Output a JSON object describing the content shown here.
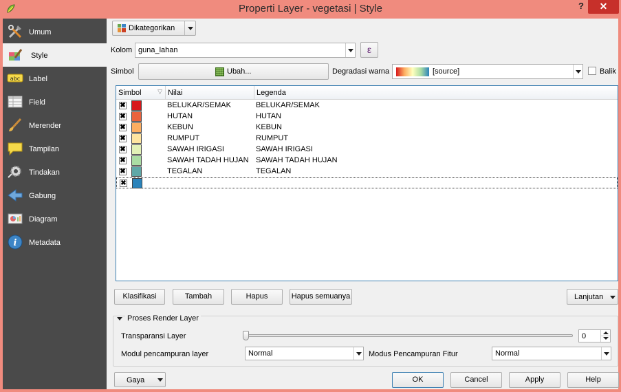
{
  "window": {
    "title": "Properti Layer - vegetasi | Style",
    "help": "?",
    "close": "✕"
  },
  "sidebar": {
    "items": [
      {
        "label": "Umum",
        "icon": "tools-icon"
      },
      {
        "label": "Style",
        "icon": "style-brush-icon",
        "active": true
      },
      {
        "label": "Label",
        "icon": "abc-label-icon"
      },
      {
        "label": "Field",
        "icon": "table-field-icon"
      },
      {
        "label": "Merender",
        "icon": "paintbrush-icon"
      },
      {
        "label": "Tampilan",
        "icon": "speech-bubble-icon"
      },
      {
        "label": "Tindakan",
        "icon": "gear-action-icon"
      },
      {
        "label": "Gabung",
        "icon": "join-arrow-icon"
      },
      {
        "label": "Diagram",
        "icon": "diagram-icon"
      },
      {
        "label": "Metadata",
        "icon": "info-icon"
      }
    ]
  },
  "renderer": {
    "type": "Dikategorikan"
  },
  "column": {
    "label": "Kolom",
    "value": "guna_lahan",
    "expr": "ε"
  },
  "symbol": {
    "label": "Simbol",
    "change": "Ubah..."
  },
  "ramp": {
    "label": "Degradasi warna",
    "value": "[source]",
    "invert_label": "Balik"
  },
  "table": {
    "headers": [
      "Simbol",
      "Nilai",
      "Legenda"
    ],
    "rows": [
      {
        "value": "BELUKAR/SEMAK",
        "legend": "BELUKAR/SEMAK",
        "color": "#d7191c"
      },
      {
        "value": "HUTAN",
        "legend": "HUTAN",
        "color": "#ea633e"
      },
      {
        "value": "KEBUN",
        "legend": "KEBUN",
        "color": "#fdae61"
      },
      {
        "value": "RUMPUT",
        "legend": "RUMPUT",
        "color": "#fee4a0"
      },
      {
        "value": "SAWAH IRIGASI",
        "legend": "SAWAH IRIGASI",
        "color": "#e3f1b7"
      },
      {
        "value": "SAWAH TADAH HUJAN",
        "legend": "SAWAH TADAH HUJAN",
        "color": "#abdda4"
      },
      {
        "value": "TEGALAN",
        "legend": "TEGALAN",
        "color": "#5fa8a8"
      },
      {
        "value": "",
        "legend": "",
        "color": "#2b83ba"
      }
    ]
  },
  "actions": {
    "classify": "Klasifikasi",
    "add": "Tambah",
    "delete": "Hapus",
    "delete_all": "Hapus semuanya",
    "advanced": "Lanjutan"
  },
  "render_group": {
    "title": "Proses Render Layer",
    "transparency_label": "Transparansi Layer",
    "transparency_value": "0",
    "transparency_level": 0,
    "layer_blend_label": "Modul pencampuran layer",
    "layer_blend_value": "Normal",
    "feature_blend_label": "Modus Pencampuran Fitur",
    "feature_blend_value": "Normal"
  },
  "footer": {
    "style": "Gaya",
    "ok": "OK",
    "cancel": "Cancel",
    "apply": "Apply",
    "help": "Help"
  }
}
